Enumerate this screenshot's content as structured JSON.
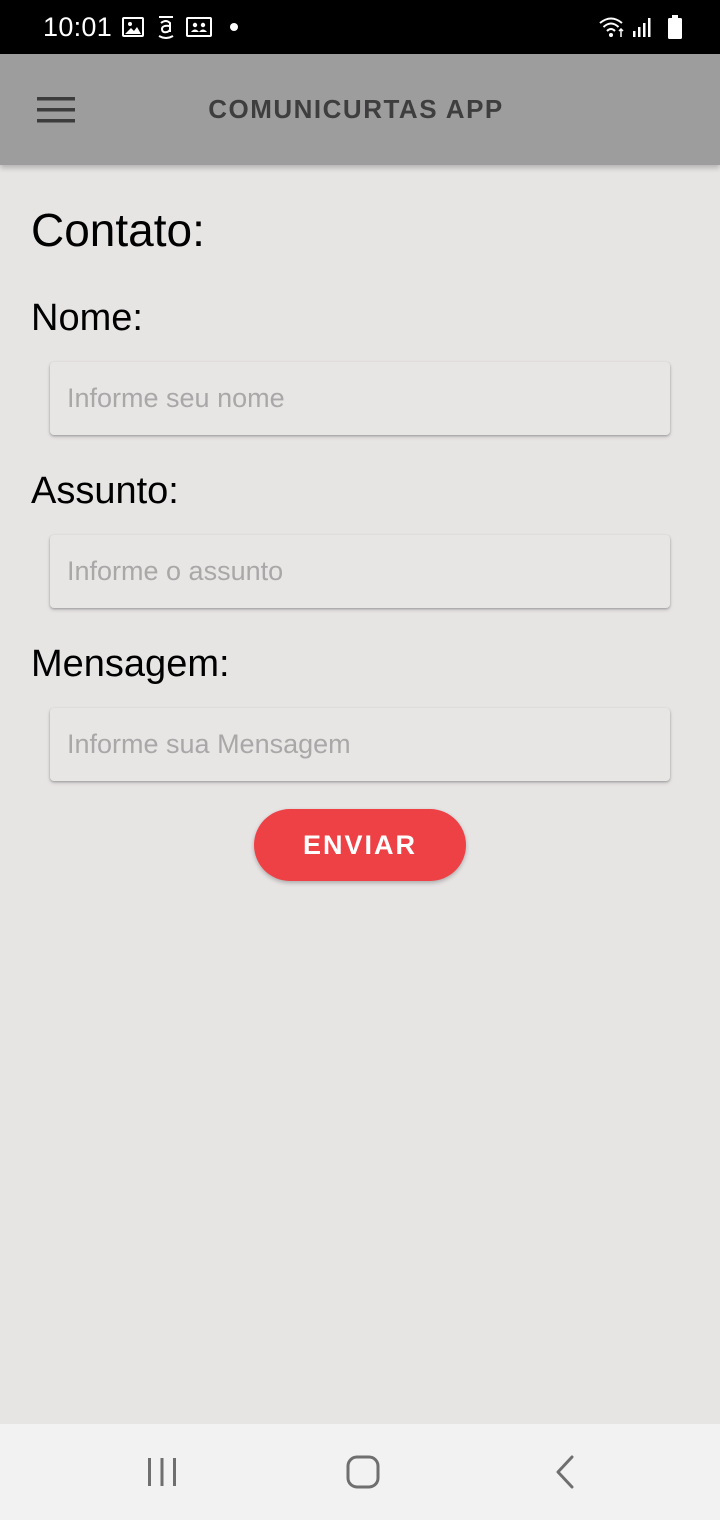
{
  "status_bar": {
    "time": "10:01",
    "left_icons": [
      "image-icon",
      "amazon-icon",
      "contacts-card-icon",
      "notification-dot-icon"
    ],
    "right_icons": [
      "wifi-icon",
      "signal-icon",
      "battery-icon"
    ]
  },
  "app_bar": {
    "title": "COMUNICURTAS APP",
    "menu_icon": "hamburger-menu-icon",
    "background": "#9e9d9e"
  },
  "form": {
    "title": "Contato:",
    "name_label": "Nome:",
    "name_placeholder": "Informe seu nome",
    "name_value": "",
    "subject_label": "Assunto:",
    "subject_placeholder": "Informe o assunto",
    "subject_value": "",
    "message_label": "Mensagem:",
    "message_placeholder": "Informe sua Mensagem",
    "message_value": "",
    "submit_label": "ENVIAR"
  },
  "colors": {
    "accent": "#ee4146",
    "page_background": "#e7e4e4"
  },
  "nav_bar": {
    "icons": [
      "recent-apps-icon",
      "home-icon",
      "back-icon"
    ]
  }
}
